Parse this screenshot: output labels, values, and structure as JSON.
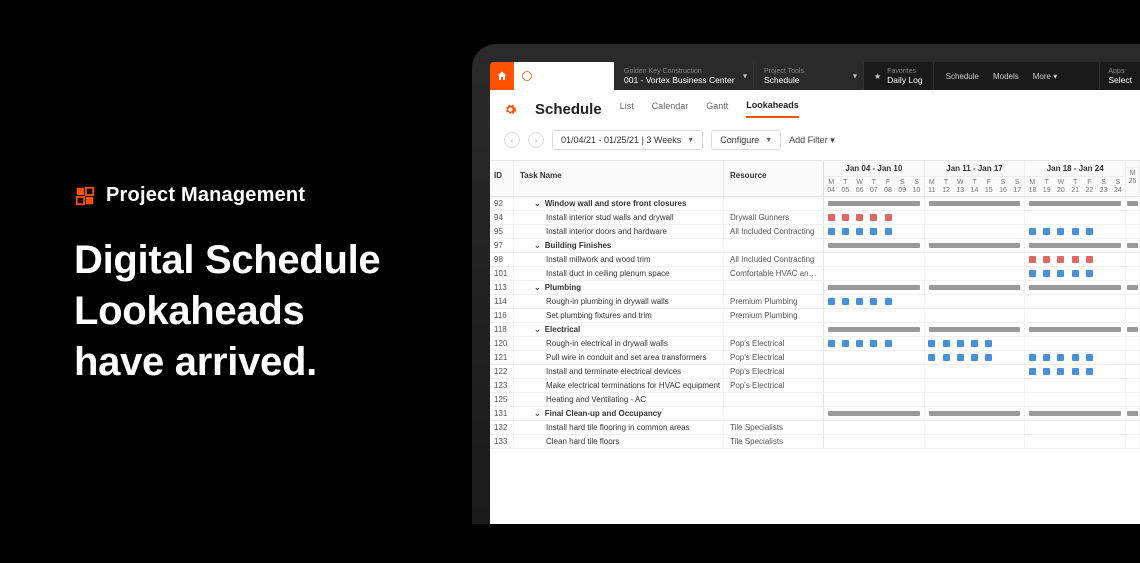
{
  "marketing": {
    "product": "Project Management",
    "headline_l1": "Digital Schedule",
    "headline_l2": "Lookaheads",
    "headline_l3": "have arrived."
  },
  "topbar": {
    "company": "Golden Key Construction",
    "project": "001 - Vortex Business Center",
    "tools_label": "Project Tools",
    "tools_value": "Schedule",
    "fav_label": "Favorites",
    "fav_value": "Daily Log",
    "nav": {
      "schedule": "Schedule",
      "models": "Models",
      "more": "More"
    },
    "apps_label": "Apps",
    "apps_value": "Select"
  },
  "page": {
    "title": "Schedule",
    "tabs": {
      "list": "List",
      "calendar": "Calendar",
      "gantt": "Gantt",
      "lookaheads": "Lookaheads"
    }
  },
  "toolbar": {
    "range": "01/04/21 - 01/25/21 | 3 Weeks",
    "configure": "Configure",
    "add_filter": "Add Filter"
  },
  "columns": {
    "id": "ID",
    "task": "Task Name",
    "resource": "Resource"
  },
  "weeks": [
    {
      "label": "Jan 04 - Jan 10",
      "days": [
        [
          "M",
          "04"
        ],
        [
          "T",
          "05"
        ],
        [
          "W",
          "06"
        ],
        [
          "T",
          "07"
        ],
        [
          "F",
          "08"
        ],
        [
          "S",
          "09"
        ],
        [
          "S",
          "10"
        ]
      ]
    },
    {
      "label": "Jan 11 - Jan 17",
      "days": [
        [
          "M",
          "11"
        ],
        [
          "T",
          "12"
        ],
        [
          "W",
          "13"
        ],
        [
          "T",
          "14"
        ],
        [
          "F",
          "15"
        ],
        [
          "S",
          "16"
        ],
        [
          "S",
          "17"
        ]
      ]
    },
    {
      "label": "Jan 18 - Jan 24",
      "days": [
        [
          "M",
          "18"
        ],
        [
          "T",
          "19"
        ],
        [
          "W",
          "20"
        ],
        [
          "T",
          "21"
        ],
        [
          "F",
          "22"
        ],
        [
          "S",
          "23"
        ],
        [
          "S",
          "24"
        ]
      ]
    },
    {
      "label": "",
      "days": [
        [
          "M",
          "25"
        ]
      ]
    }
  ],
  "rows": [
    {
      "id": "92",
      "group": true,
      "indent": 1,
      "task": "Window wall and store front closures",
      "resource": "",
      "bars": {
        "summary": true
      }
    },
    {
      "id": "94",
      "group": false,
      "indent": 2,
      "task": "Install interior stud walls and drywall",
      "resource": "Drywall Gunners",
      "cells": [
        [
          0,
          "red"
        ],
        [
          1,
          "red"
        ],
        [
          2,
          "red"
        ],
        [
          3,
          "red"
        ],
        [
          4,
          "red"
        ]
      ],
      "week2": [],
      "week3": []
    },
    {
      "id": "95",
      "group": false,
      "indent": 2,
      "task": "Install interior doors and hardware",
      "resource": "All Included Contracting",
      "cells": [
        [
          0,
          "blue"
        ],
        [
          1,
          "blue"
        ],
        [
          2,
          "blue"
        ],
        [
          3,
          "blue"
        ],
        [
          4,
          "blue"
        ]
      ],
      "week2": [],
      "week3": [
        [
          0,
          "blue"
        ],
        [
          1,
          "blue"
        ],
        [
          2,
          "blue"
        ],
        [
          3,
          "blue"
        ],
        [
          4,
          "blue"
        ]
      ]
    },
    {
      "id": "97",
      "group": true,
      "indent": 1,
      "task": "Building Finishes",
      "resource": "",
      "bars": {
        "summary": true
      }
    },
    {
      "id": "98",
      "group": false,
      "indent": 2,
      "task": "Install millwork and wood trim",
      "resource": "All Included Contracting",
      "cells": [],
      "week2": [],
      "week3": [
        [
          0,
          "red"
        ],
        [
          1,
          "red"
        ],
        [
          2,
          "red"
        ],
        [
          3,
          "red"
        ],
        [
          4,
          "red"
        ]
      ]
    },
    {
      "id": "101",
      "group": false,
      "indent": 2,
      "task": "Install duct in ceiling plenum space",
      "resource": "Comfortable HVAC and Duct",
      "cells": [],
      "week2": [],
      "week3": [
        [
          0,
          "blue"
        ],
        [
          1,
          "blue"
        ],
        [
          2,
          "blue"
        ],
        [
          3,
          "blue"
        ],
        [
          4,
          "blue"
        ]
      ]
    },
    {
      "id": "113",
      "group": true,
      "indent": 1,
      "task": "Plumbing",
      "resource": "",
      "bars": {
        "summary": true
      }
    },
    {
      "id": "114",
      "group": false,
      "indent": 2,
      "task": "Rough-in plumbing in drywall walls",
      "resource": "Premium Plumbing",
      "cells": [
        [
          0,
          "blue"
        ],
        [
          1,
          "blue"
        ],
        [
          2,
          "blue"
        ],
        [
          3,
          "blue"
        ],
        [
          4,
          "blue"
        ]
      ],
      "week2": [],
      "week3": []
    },
    {
      "id": "116",
      "group": false,
      "indent": 2,
      "task": "Set plumbing fixtures and trim",
      "resource": "Premium Plumbing",
      "cells": [],
      "week2": [],
      "week3": []
    },
    {
      "id": "118",
      "group": true,
      "indent": 1,
      "task": "Electrical",
      "resource": "",
      "bars": {
        "summary": true
      }
    },
    {
      "id": "120",
      "group": false,
      "indent": 2,
      "task": "Rough-in electrical in drywall walls",
      "resource": "Pop's Electrical",
      "cells": [
        [
          0,
          "blue"
        ],
        [
          1,
          "blue"
        ],
        [
          2,
          "blue"
        ],
        [
          3,
          "blue"
        ],
        [
          4,
          "blue"
        ]
      ],
      "week2": [
        [
          0,
          "blue"
        ],
        [
          1,
          "blue"
        ],
        [
          2,
          "blue"
        ],
        [
          3,
          "blue"
        ],
        [
          4,
          "blue"
        ]
      ],
      "week3": []
    },
    {
      "id": "121",
      "group": false,
      "indent": 2,
      "task": "Pull wire in conduit and set area transformers",
      "resource": "Pop's Electrical",
      "cells": [],
      "week2": [
        [
          0,
          "blue"
        ],
        [
          1,
          "blue"
        ],
        [
          2,
          "blue"
        ],
        [
          3,
          "blue"
        ],
        [
          4,
          "blue"
        ]
      ],
      "week3": [
        [
          0,
          "blue"
        ],
        [
          1,
          "blue"
        ],
        [
          2,
          "blue"
        ],
        [
          3,
          "blue"
        ],
        [
          4,
          "blue"
        ]
      ]
    },
    {
      "id": "122",
      "group": false,
      "indent": 2,
      "task": "Install and terminate electrical devices",
      "resource": "Pop's Electrical",
      "cells": [],
      "week2": [],
      "week3": [
        [
          0,
          "blue"
        ],
        [
          1,
          "blue"
        ],
        [
          2,
          "blue"
        ],
        [
          3,
          "blue"
        ],
        [
          4,
          "blue"
        ]
      ]
    },
    {
      "id": "123",
      "group": false,
      "indent": 2,
      "task": "Make electrical terminations for HVAC equipment",
      "resource": "Pop's Electrical",
      "cells": [],
      "week2": [],
      "week3": []
    },
    {
      "id": "125",
      "group": false,
      "indent": 2,
      "task": "Heating and Ventilating - AC",
      "resource": "",
      "cells": [],
      "week2": [],
      "week3": []
    },
    {
      "id": "131",
      "group": true,
      "indent": 1,
      "task": "Final Clean-up and Occupancy",
      "resource": "",
      "bars": {
        "summary": true
      }
    },
    {
      "id": "132",
      "group": false,
      "indent": 2,
      "task": "Install hard tile flooring in common areas",
      "resource": "Tile Specialists",
      "cells": [],
      "week2": [],
      "week3": []
    },
    {
      "id": "133",
      "group": false,
      "indent": 2,
      "task": "Clean hard tile floors",
      "resource": "Tile Specialists",
      "cells": [],
      "week2": [],
      "week3": []
    }
  ]
}
